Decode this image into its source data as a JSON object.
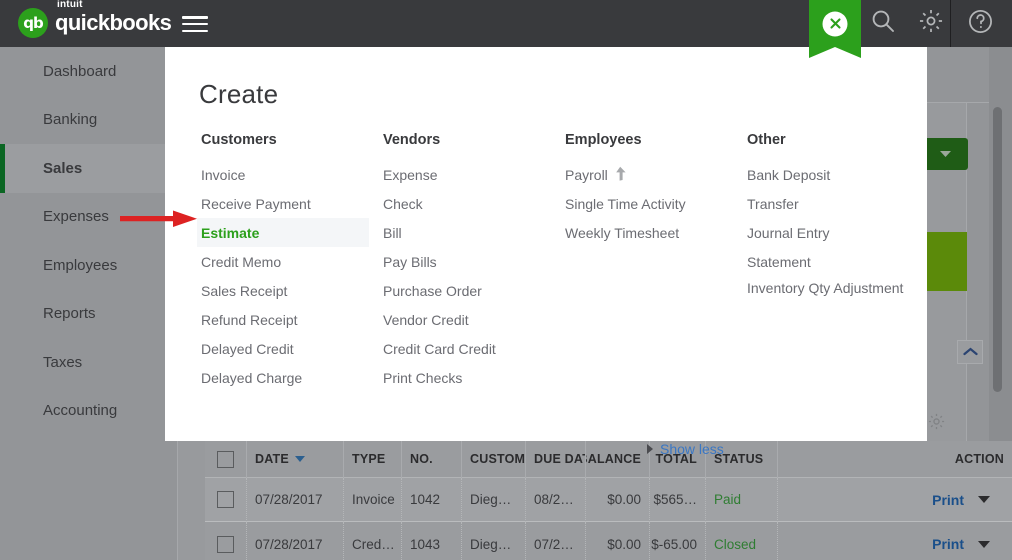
{
  "topbar": {
    "logo_intuit": "intuit",
    "logo_mark": "qb",
    "logo_name": "quickbooks",
    "menu_icon": "hamburger-menu-icon",
    "create_tab_icon": "close-icon",
    "search_icon": "search-icon",
    "settings_icon": "gear-icon",
    "help_icon": "help-circle-icon"
  },
  "sidebar": {
    "items": [
      {
        "label": "Dashboard",
        "active": false
      },
      {
        "label": "Banking",
        "active": false
      },
      {
        "label": "Sales",
        "active": true
      },
      {
        "label": "Expenses",
        "active": false
      },
      {
        "label": "Employees",
        "active": false
      },
      {
        "label": "Reports",
        "active": false
      },
      {
        "label": "Taxes",
        "active": false
      },
      {
        "label": "Accounting",
        "active": false
      }
    ]
  },
  "create_panel": {
    "title": "Create",
    "columns": [
      {
        "heading": "Customers",
        "items": [
          {
            "label": "Invoice"
          },
          {
            "label": "Receive Payment"
          },
          {
            "label": "Estimate",
            "highlighted": true
          },
          {
            "label": "Credit Memo"
          },
          {
            "label": "Sales Receipt"
          },
          {
            "label": "Refund Receipt"
          },
          {
            "label": "Delayed Credit"
          },
          {
            "label": "Delayed Charge"
          }
        ]
      },
      {
        "heading": "Vendors",
        "items": [
          {
            "label": "Expense"
          },
          {
            "label": "Check"
          },
          {
            "label": "Bill"
          },
          {
            "label": "Pay Bills"
          },
          {
            "label": "Purchase Order"
          },
          {
            "label": "Vendor Credit"
          },
          {
            "label": "Credit Card Credit"
          },
          {
            "label": "Print Checks"
          }
        ]
      },
      {
        "heading": "Employees",
        "items": [
          {
            "label": "Payroll",
            "icon": "arrow-up-icon"
          },
          {
            "label": "Single Time Activity"
          },
          {
            "label": "Weekly Timesheet"
          }
        ]
      },
      {
        "heading": "Other",
        "items": [
          {
            "label": "Bank Deposit"
          },
          {
            "label": "Transfer"
          },
          {
            "label": "Journal Entry"
          },
          {
            "label": "Statement"
          },
          {
            "label": "Inventory Qty Adjustment",
            "wrap": true
          }
        ]
      }
    ],
    "show_less": "Show less",
    "show_less_icon": "triangle-right-icon"
  },
  "table": {
    "headers": [
      "DATE",
      "TYPE",
      "NO.",
      "CUSTOMER",
      "DUE DATE",
      "BALANCE",
      "TOTAL",
      "STATUS",
      "ACTION"
    ],
    "sort_column": "DATE",
    "rows": [
      {
        "date": "07/28/2017",
        "type": "Invoice",
        "no": "1042",
        "customer": "Dieg…",
        "due_date": "08/2…",
        "balance": "$0.00",
        "total": "$565…",
        "status": "Paid",
        "action": "Print"
      },
      {
        "date": "07/28/2017",
        "type": "Cred…",
        "no": "1043",
        "customer": "Dieg…",
        "due_date": "07/2…",
        "balance": "$0.00",
        "total": "$-65.00",
        "status": "Closed",
        "action": "Print"
      }
    ]
  },
  "annotation": {
    "arrow": "red-pointer-arrow",
    "points_to": "Estimate"
  },
  "background": {
    "dropdown_icon": "chevron-down-icon",
    "collapse_icon": "chevron-up-icon",
    "settings_icon": "gear-icon",
    "scrollbar": "vertical-scrollbar"
  },
  "colors": {
    "brand_green": "#2ca01c",
    "dark_header": "#393a3d",
    "link_blue": "#3a77c4",
    "dim_gray": "#939598"
  }
}
